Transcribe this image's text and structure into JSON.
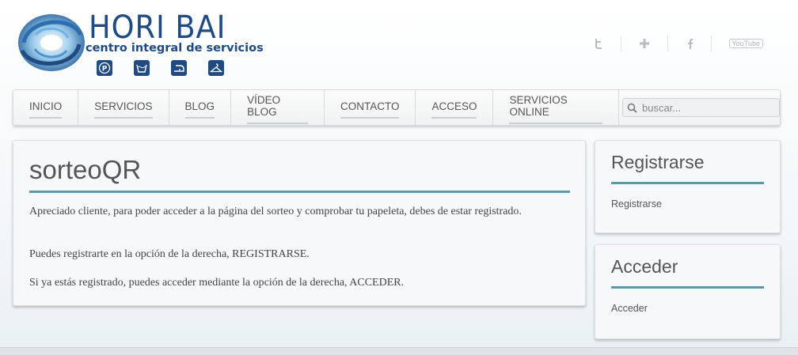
{
  "brand": {
    "name": "HORI BAI",
    "tagline": "centro integral de servicios",
    "service_icons": [
      "parking-icon",
      "laundry-icon",
      "ironing-icon",
      "hanger-icon"
    ],
    "color": "#1f4a82"
  },
  "social": {
    "items": [
      "twitter-icon",
      "google-plus-icon",
      "facebook-icon",
      "youtube-icon"
    ],
    "youtube_label": "YouTube"
  },
  "nav": {
    "items": [
      {
        "label": "INICIO"
      },
      {
        "label": "SERVICIOS"
      },
      {
        "label": "BLOG"
      },
      {
        "label": "VÍDEO BLOG"
      },
      {
        "label": "CONTACTO"
      },
      {
        "label": "ACCESO"
      },
      {
        "label": "SERVICIOS ONLINE"
      }
    ],
    "search_placeholder": "buscar..."
  },
  "main": {
    "title": "sorteoQR",
    "paragraphs": [
      "Apreciado cliente, para poder acceder a la página del sorteo y comprobar tu papeleta, debes de estar registrado.",
      "Puedes registrarte en la opción de la derecha, REGISTRARSE.",
      "Si ya estás registrado, puedes acceder mediante la opción de la derecha, ACCEDER."
    ]
  },
  "sidebar": {
    "register": {
      "title": "Registrarse",
      "link": "Registrarse"
    },
    "login": {
      "title": "Acceder",
      "link": "Acceder"
    }
  },
  "colors": {
    "accent_rule": "#5b98a8",
    "brand_blue": "#1f4a82"
  }
}
